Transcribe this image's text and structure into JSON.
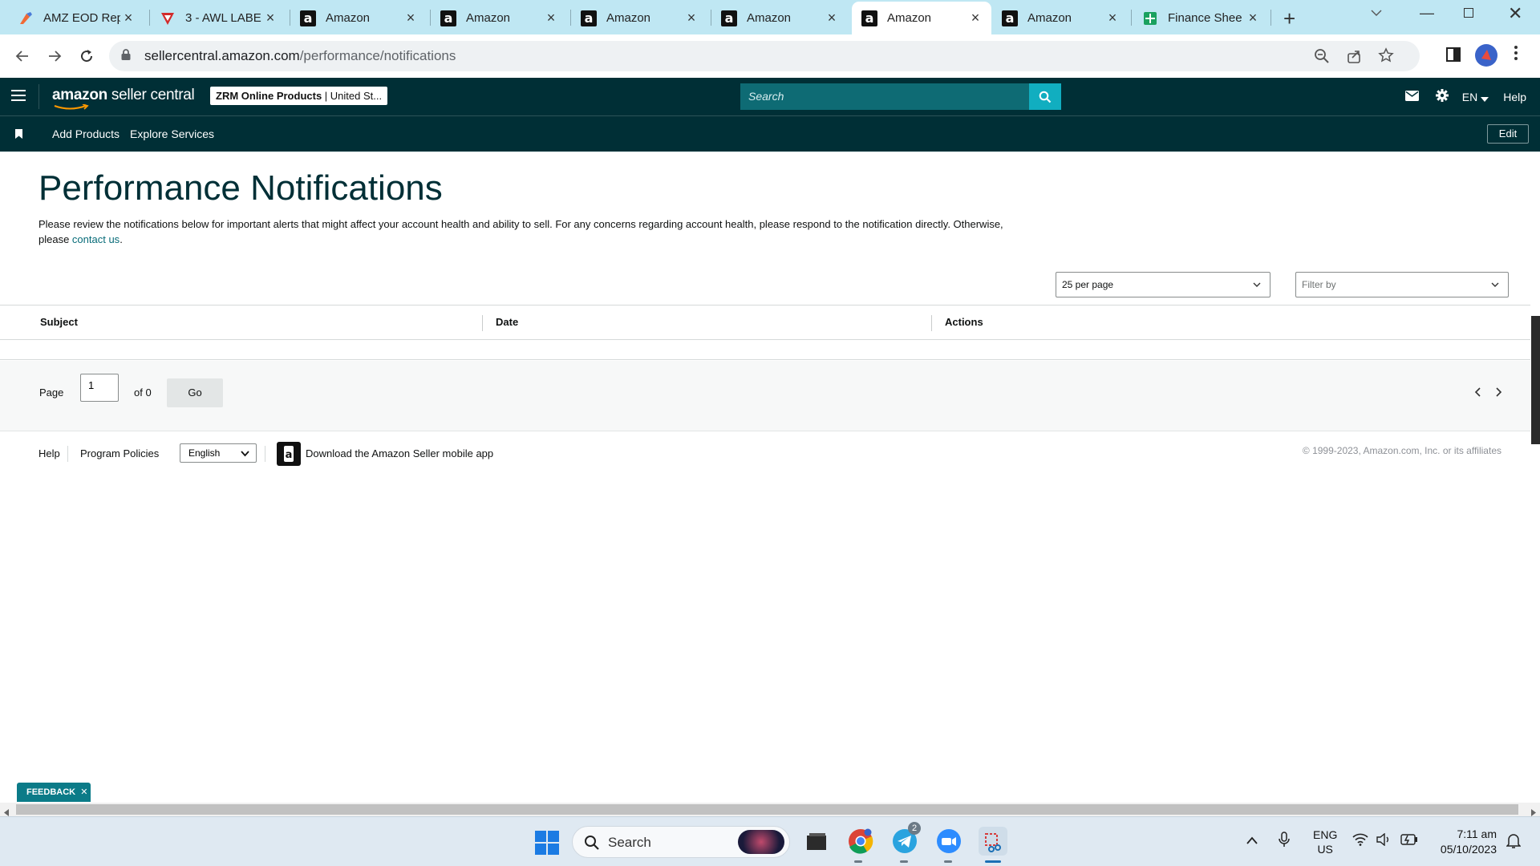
{
  "browser": {
    "tabs": [
      {
        "title": "AMZ EOD Rep",
        "icon": "tool-icon",
        "active": false
      },
      {
        "title": "3 - AWL LABE",
        "icon": "sheet-v-icon",
        "active": false
      },
      {
        "title": "Amazon",
        "icon": "amazon-icon",
        "active": false
      },
      {
        "title": "Amazon",
        "icon": "amazon-icon",
        "active": false
      },
      {
        "title": "Amazon",
        "icon": "amazon-icon",
        "active": false
      },
      {
        "title": "Amazon",
        "icon": "amazon-icon",
        "active": false
      },
      {
        "title": "Amazon",
        "icon": "amazon-icon",
        "active": true
      },
      {
        "title": "Amazon",
        "icon": "amazon-icon",
        "active": false
      },
      {
        "title": "Finance Shee",
        "icon": "sheets-icon",
        "active": false
      }
    ],
    "url_domain": "sellercentral.amazon.com",
    "url_path": "/performance/notifications"
  },
  "header": {
    "logo_brand": "amazon",
    "logo_product": " seller central",
    "account_name": "ZRM Online Products",
    "account_region": " | United St...",
    "search_placeholder": "Search",
    "language": "EN",
    "help": "Help"
  },
  "nav": {
    "add_products": "Add Products",
    "explore_services": "Explore Services",
    "edit": "Edit"
  },
  "page": {
    "title": "Performance Notifications",
    "intro": "Please review the notifications below for important alerts that might affect your account health and ability to sell. For any concerns regarding account health, please respond to the notification directly. Otherwise, please ",
    "contact_link": "contact us",
    "intro_end": "."
  },
  "controls": {
    "per_page": "25 per page",
    "filter": "Filter by"
  },
  "table": {
    "columns": [
      "Subject",
      "Date",
      "Actions"
    ]
  },
  "pagination": {
    "page_label": "Page",
    "page_value": "1",
    "of_label": "of 0",
    "go": "Go"
  },
  "footer": {
    "help": "Help",
    "program_policies": "Program Policies",
    "language": "English",
    "download_app": "Download the Amazon Seller mobile app",
    "copyright": "© 1999-2023, Amazon.com, Inc. or its affiliates"
  },
  "feedback": "FEEDBACK",
  "taskbar": {
    "search": "Search",
    "telegram_badge": "2",
    "lang_top": "ENG",
    "lang_bottom": "US",
    "time": "7:11 am",
    "date": "05/10/2023"
  },
  "colors": {
    "header_bg": "#002f36",
    "search_bg": "#0e6b74",
    "search_btn": "#11aec0",
    "link": "#076b78",
    "tabstrip": "#bfe7f3"
  }
}
